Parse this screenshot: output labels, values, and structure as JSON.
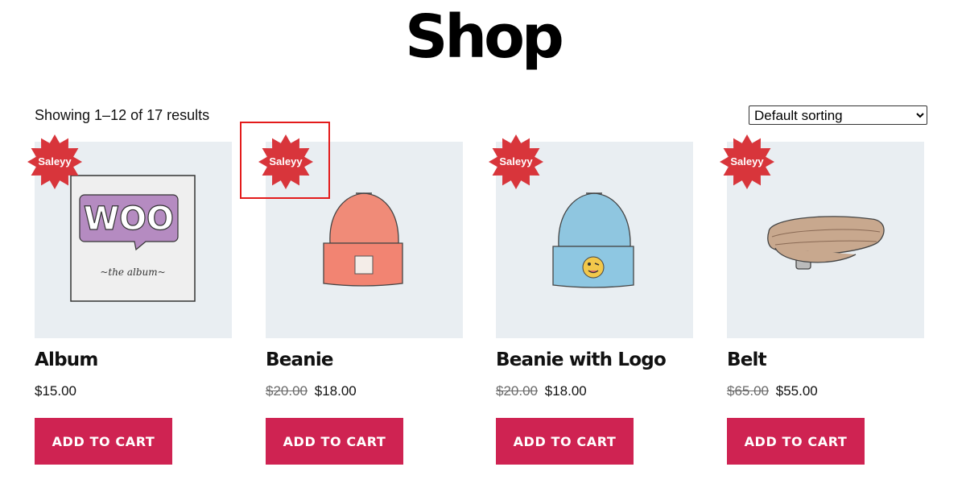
{
  "page": {
    "title": "Shop"
  },
  "toolbar": {
    "result_count": "Showing 1–12 of 17 results",
    "sort_selected": "Default sorting"
  },
  "colors": {
    "sale_badge": "#d8353b",
    "button": "#cf2352",
    "thumb_bg": "#e9eef2",
    "annotation_box": "#e31b1b"
  },
  "products": [
    {
      "name": "Album",
      "sale_label": "Saleyy",
      "regular_price": "",
      "price": "$15.00",
      "button": "Add to cart",
      "image_icon": "woo-album-icon"
    },
    {
      "name": "Beanie",
      "sale_label": "Saleyy",
      "regular_price": "$20.00",
      "price": "$18.00",
      "button": "Add to cart",
      "image_icon": "orange-beanie-icon"
    },
    {
      "name": "Beanie with Logo",
      "sale_label": "Saleyy",
      "regular_price": "$20.00",
      "price": "$18.00",
      "button": "Add to cart",
      "image_icon": "blue-beanie-icon"
    },
    {
      "name": "Belt",
      "sale_label": "Saleyy",
      "regular_price": "$65.00",
      "price": "$55.00",
      "button": "Add to cart",
      "image_icon": "belt-icon"
    }
  ]
}
